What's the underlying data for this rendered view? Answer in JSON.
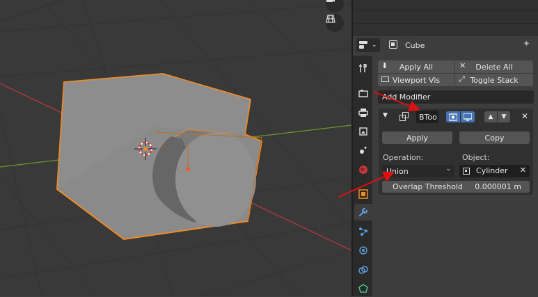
{
  "header": {
    "object_name": "Cube"
  },
  "toolbar": {
    "apply_all": "Apply All",
    "delete_all": "Delete All",
    "viewport_vis": "Viewport Vis",
    "toggle_stack": "Toggle Stack",
    "add_modifier": "Add Modifier"
  },
  "modifier": {
    "name": "BToo",
    "apply": "Apply",
    "copy": "Copy",
    "operation_label": "Operation:",
    "operation_value": "Union",
    "object_label": "Object:",
    "object_value": "Cylinder",
    "overlap_label": "Overlap Threshold",
    "overlap_value": "0.000001 m"
  },
  "colors": {
    "selection_outline": "#f08a24",
    "annotation_arrow": "#e01010",
    "active_button": "#4772b3",
    "x_axis": "#c0393f",
    "y_axis": "#6a9a2a"
  },
  "icons": [
    "camera-icon",
    "grid-icon",
    "editor-type-icon",
    "object-data-icon",
    "pin-icon",
    "tool-icon",
    "render-icon",
    "output-icon",
    "view-layer-icon",
    "scene-icon",
    "world-icon",
    "object-icon",
    "wrench-icon",
    "particles-icon",
    "physics-icon",
    "constraints-icon",
    "data-icon"
  ]
}
